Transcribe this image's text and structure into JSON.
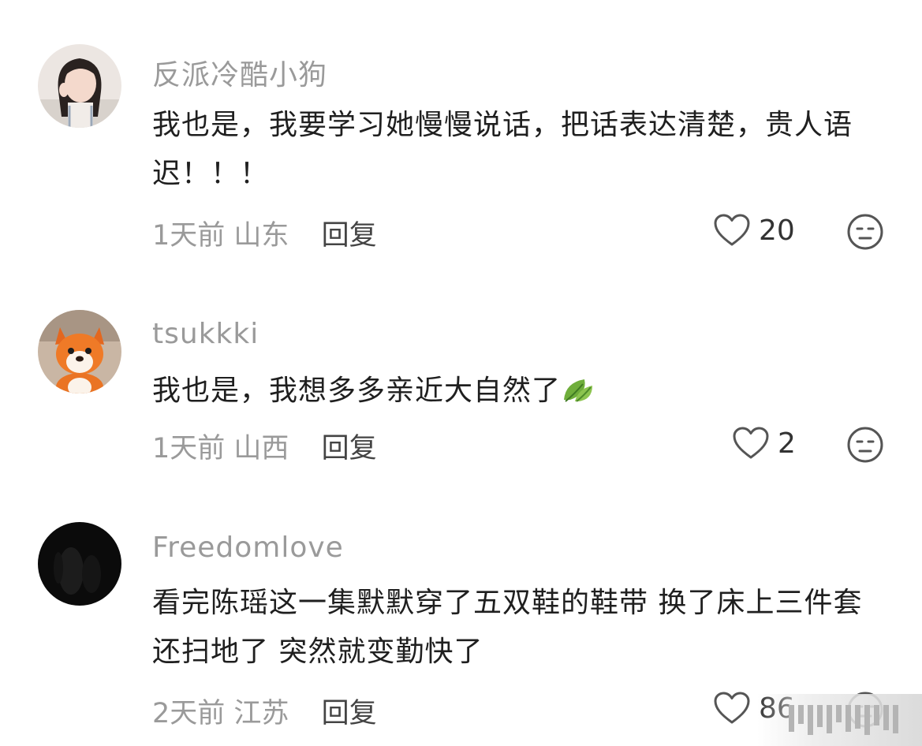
{
  "comments": [
    {
      "username": "反派冷酷小狗",
      "text": "我也是，我要学习她慢慢说话，把话表达清楚，贵人语迟！！！",
      "time": "1天前",
      "location": "山东",
      "reply_label": "回复",
      "likes": "20",
      "avatar_icon": "girl-portrait-avatar"
    },
    {
      "username": "tsukkki",
      "text": "我也是，我想多多亲近大自然了",
      "emoji": "leaf-emoji",
      "time": "1天前",
      "location": "山西",
      "reply_label": "回复",
      "likes": "2",
      "avatar_icon": "fox-plush-avatar"
    },
    {
      "username": "Freedomlove",
      "text": "看完陈瑶这一集默默穿了五双鞋的鞋带 换了床上三件套还扫地了 突然就变勤快了",
      "time": "2天前",
      "location": "江苏",
      "reply_label": "回复",
      "likes": "86",
      "avatar_icon": "dark-avatar"
    }
  ],
  "colors": {
    "username": "#9a9a9a",
    "text": "#1f1f1f",
    "meta": "#9a9a9a",
    "icon": "#555555"
  }
}
